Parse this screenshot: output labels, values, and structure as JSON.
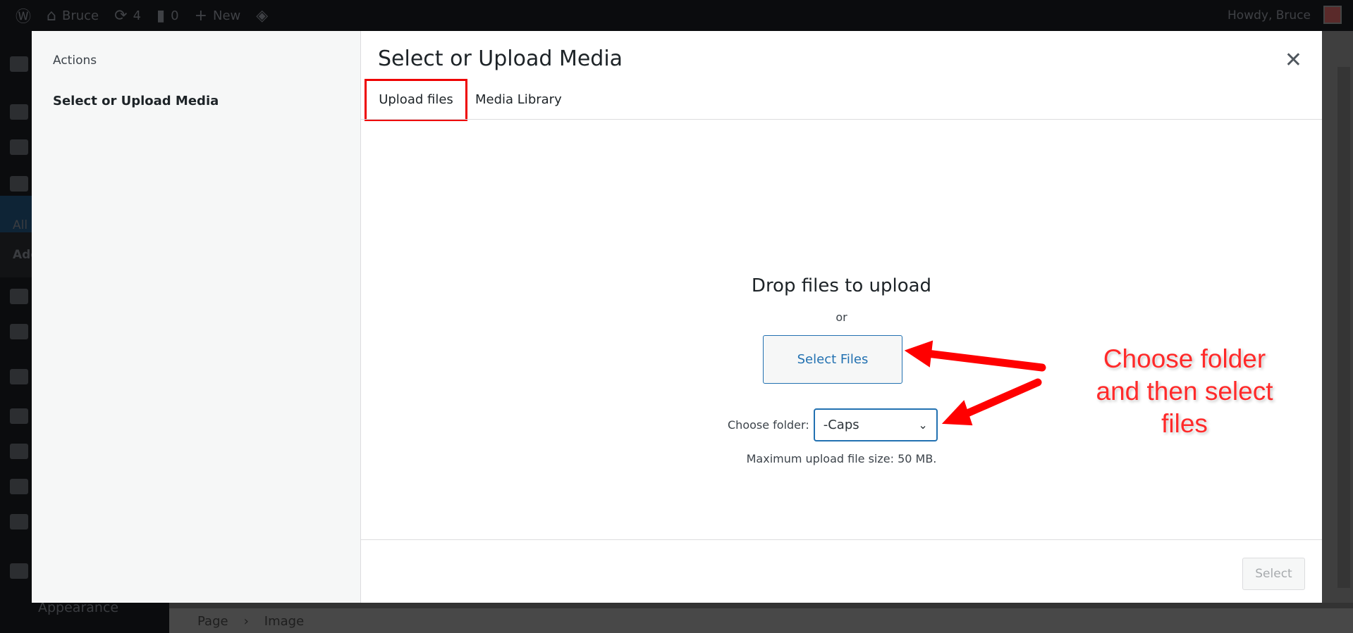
{
  "adminbar": {
    "site": "Bruce",
    "updates": "4",
    "comments": "0",
    "new_label": "New",
    "howdy": "Howdy, Bruce"
  },
  "sidebar": {
    "sub_items": [
      "All",
      "Add"
    ],
    "appearance": "Appearance"
  },
  "breadcrumb": [
    "Page",
    "Image"
  ],
  "modal": {
    "menu": {
      "heading": "Actions",
      "active": "Select or Upload Media"
    },
    "title": "Select or Upload Media",
    "tabs": [
      {
        "label": "Upload files",
        "active": true
      },
      {
        "label": "Media Library"
      }
    ],
    "uploader": {
      "drop_text": "Drop files to upload",
      "or": "or",
      "select_files": "Select Files",
      "folder_label": "Choose folder:",
      "folder_value": "-Caps",
      "max_size": "Maximum upload file size: 50 MB."
    },
    "select_button": "Select"
  },
  "annotation": {
    "lines": [
      "Choose folder",
      "and then select",
      "files"
    ],
    "color": "#ff0000"
  }
}
